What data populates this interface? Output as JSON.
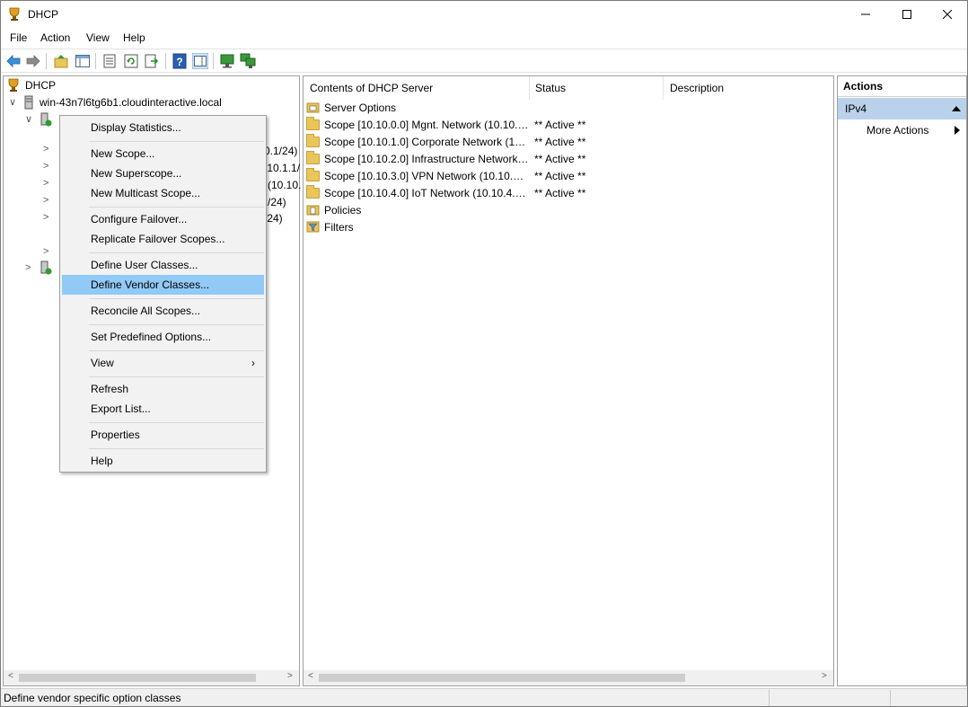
{
  "window": {
    "title": "DHCP"
  },
  "menubar": [
    "File",
    "Action",
    "View",
    "Help"
  ],
  "tree": {
    "root": "DHCP",
    "server": "win-43n7l6tg6b1.cloudinteractive.local",
    "ipv4": "IPv4",
    "partial_labels": [
      "0.1/24)",
      ".10.1.1/",
      "(10.10.",
      "/24)",
      "/24)"
    ]
  },
  "content": {
    "columns": [
      "Contents of DHCP Server",
      "Status",
      "Description"
    ],
    "rows": [
      {
        "name": "Server Options",
        "status": ""
      },
      {
        "name": "Scope [10.10.0.0] Mgnt. Network (10.10.0....",
        "status": "** Active **"
      },
      {
        "name": "Scope [10.10.1.0] Corporate Network (10....",
        "status": "** Active **"
      },
      {
        "name": "Scope [10.10.2.0] Infrastructure Network (...",
        "status": "** Active **"
      },
      {
        "name": "Scope [10.10.3.0] VPN Network (10.10.3.1...",
        "status": "** Active **"
      },
      {
        "name": "Scope [10.10.4.0] IoT Network (10.10.4.1/...",
        "status": "** Active **"
      },
      {
        "name": "Policies",
        "status": ""
      },
      {
        "name": "Filters",
        "status": ""
      }
    ]
  },
  "actions": {
    "title": "Actions",
    "section": "IPv4",
    "more": "More Actions"
  },
  "context_menu": {
    "items": [
      "Display Statistics...",
      "New Scope...",
      "New Superscope...",
      "New Multicast Scope...",
      "Configure Failover...",
      "Replicate Failover Scopes...",
      "Define User Classes...",
      "Define Vendor Classes...",
      "Reconcile All Scopes...",
      "Set Predefined Options...",
      "View",
      "Refresh",
      "Export List...",
      "Properties",
      "Help"
    ],
    "highlighted": "Define Vendor Classes..."
  },
  "statusbar": {
    "text": "Define vendor specific option classes"
  }
}
